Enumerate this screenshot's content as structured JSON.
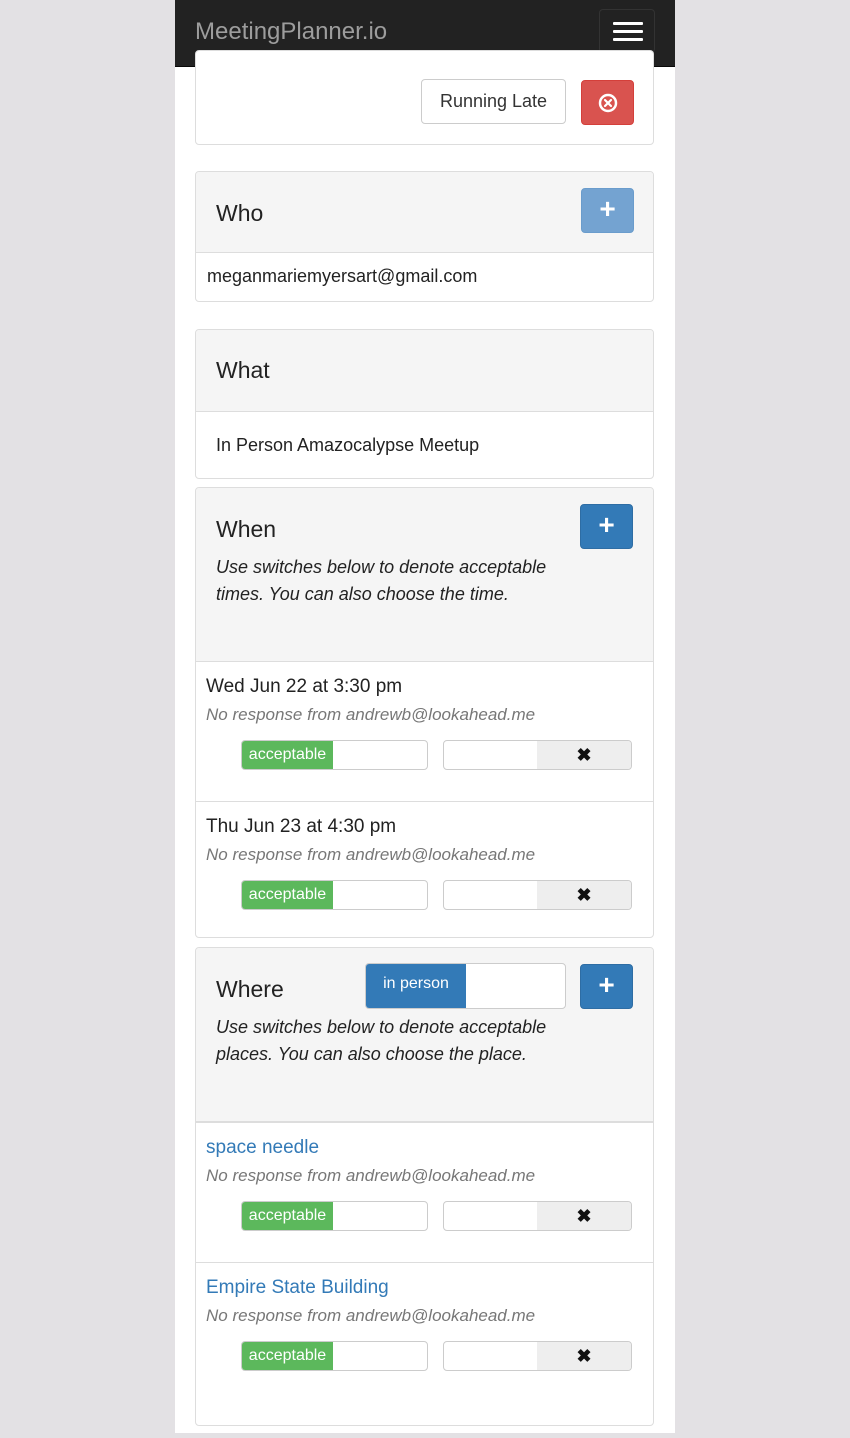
{
  "navbar": {
    "brand": "MeetingPlanner.io",
    "menu_icon": "hamburger-menu-icon"
  },
  "top_actions": {
    "running_late_label": "Running Late",
    "cancel_icon": "circle-x-icon",
    "cancel_color": "#d9534f"
  },
  "who": {
    "title": "Who",
    "add_icon": "plus-icon",
    "participants": [
      "meganmariemyersart@gmail.com"
    ]
  },
  "what": {
    "title": "What",
    "description": "In Person Amazocalypse Meetup"
  },
  "when": {
    "title": "When",
    "add_icon": "plus-icon",
    "help": "Use switches below to denote acceptable times.  You can also choose the time.",
    "items": [
      {
        "label": "Wed Jun 22 at 3:30 pm",
        "status": "No response from andrewb@lookahead.me",
        "switch_on_label": "acceptable",
        "switch_off_icon": "x-icon"
      },
      {
        "label": "Thu Jun 23 at 4:30 pm",
        "status": "No response from andrewb@lookahead.me",
        "switch_on_label": "acceptable",
        "switch_off_icon": "x-icon"
      }
    ]
  },
  "where": {
    "title": "Where",
    "mode_switch_label": "in person",
    "add_icon": "plus-icon",
    "help": "Use switches below to denote acceptable places.  You can also choose the place.",
    "items": [
      {
        "label": "space needle",
        "status": "No response from andrewb@lookahead.me",
        "switch_on_label": "acceptable",
        "switch_off_icon": "x-icon"
      },
      {
        "label": "Empire State Building",
        "status": "No response from andrewb@lookahead.me",
        "switch_on_label": "acceptable",
        "switch_off_icon": "x-icon"
      }
    ]
  },
  "colors": {
    "primary": "#337ab7",
    "success": "#5cb85c",
    "danger": "#d9534f",
    "navbar": "#222222"
  }
}
